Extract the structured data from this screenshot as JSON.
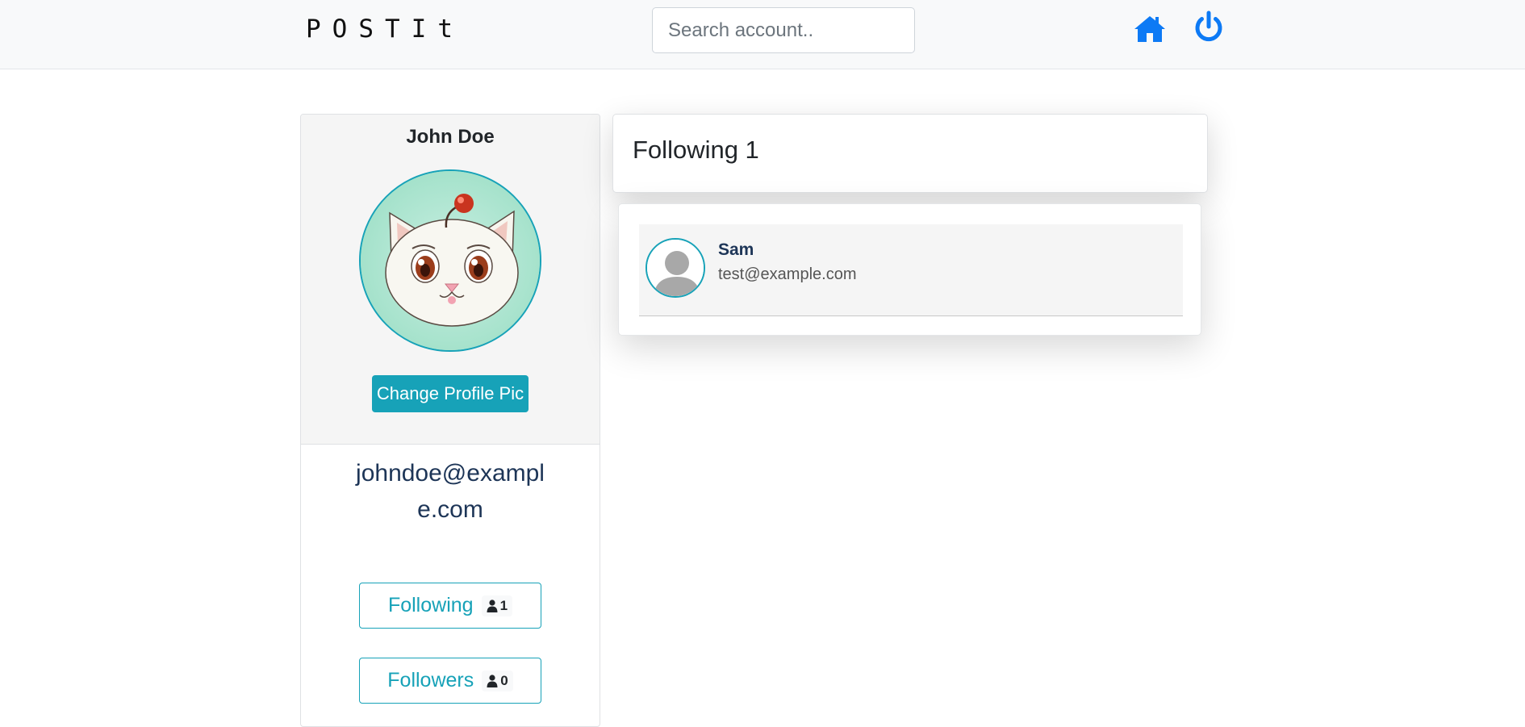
{
  "navbar": {
    "brand": "POSTIt",
    "search_placeholder": "Search account..",
    "icons": [
      "home-icon",
      "power-icon"
    ],
    "accent_color": "#0d7af5"
  },
  "profile": {
    "name": "John Doe",
    "change_pic_label": "Change Profile Pic",
    "email": "johndoe@example.com",
    "following_label": "Following",
    "following_count": "1",
    "followers_label": "Followers",
    "followers_count": "0",
    "accent_color": "#17a2b8"
  },
  "following_panel": {
    "title": "Following 1",
    "users": [
      {
        "name": "Sam",
        "email": "test@example.com"
      }
    ]
  }
}
